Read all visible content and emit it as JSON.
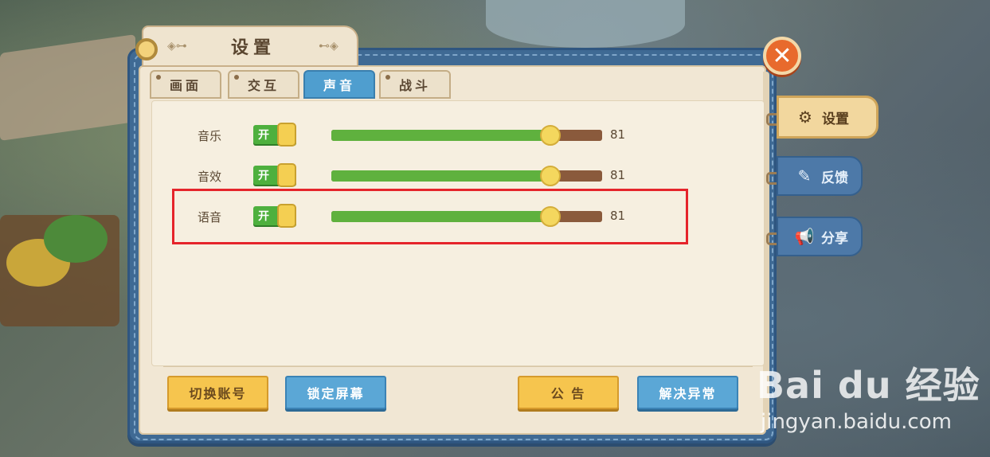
{
  "window": {
    "title": "设置",
    "close_icon": "close-icon"
  },
  "tabs": [
    {
      "label": "画面",
      "active": false
    },
    {
      "label": "交互",
      "active": false
    },
    {
      "label": "声音",
      "active": true
    },
    {
      "label": "战斗",
      "active": false
    }
  ],
  "sound": [
    {
      "label": "音乐",
      "toggle": "开",
      "on": true,
      "value": "81",
      "level": 81
    },
    {
      "label": "音效",
      "toggle": "开",
      "on": true,
      "value": "81",
      "level": 81
    },
    {
      "label": "语音",
      "toggle": "开",
      "on": true,
      "value": "81",
      "level": 81
    }
  ],
  "slider_max": 100,
  "footer": {
    "switch_account": "切换账号",
    "lock_screen": "锁定屏幕",
    "announcement": "公 告",
    "fix_issues": "解决异常"
  },
  "side_tabs": [
    {
      "label": "设置",
      "icon": "gear-icon",
      "active": true
    },
    {
      "label": "反馈",
      "icon": "feedback-icon",
      "active": false
    },
    {
      "label": "分享",
      "icon": "megaphone-icon",
      "active": false
    }
  ],
  "watermark": {
    "logo": "Bai du 经验",
    "url": "jingyan.baidu.com"
  },
  "colors": {
    "accent_tab": "#4f9ecf",
    "toggle_on": "#4eb03e",
    "slider_fill": "#5fb13e",
    "slider_track": "#8a5a3c",
    "highlight": "#e5242b",
    "close": "#e86a2d"
  }
}
